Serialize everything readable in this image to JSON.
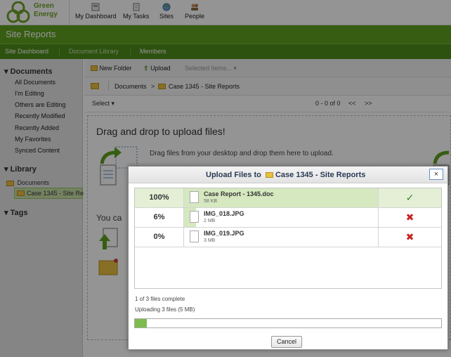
{
  "brand": {
    "name_line1": "Green",
    "name_line2": "Energy"
  },
  "nav": [
    {
      "label": "My Dashboard",
      "icon": "dashboard-icon"
    },
    {
      "label": "My Tasks",
      "icon": "tasks-icon"
    },
    {
      "label": "Sites",
      "icon": "sites-icon"
    },
    {
      "label": "People",
      "icon": "people-icon"
    }
  ],
  "site_title": "Site Reports",
  "subnav": {
    "dashboard": "Site Dashboard",
    "library": "Document Library",
    "members": "Members"
  },
  "sidebar": {
    "documents_header": "Documents",
    "documents": [
      "All Documents",
      "I'm Editing",
      "Others are Editing",
      "Recently Modified",
      "Recently Added",
      "My Favorites",
      "Synced Content"
    ],
    "library_header": "Library",
    "library_root": "Documents",
    "library_child": "Case 1345 - Site Re",
    "tags_header": "Tags"
  },
  "toolbar": {
    "new_folder": "New Folder",
    "upload": "Upload",
    "selected_items": "Selected Items..."
  },
  "breadcrumb": {
    "root": "Documents",
    "sep": ">",
    "folder": "Case 1345 - Site Reports"
  },
  "filter": {
    "select": "Select",
    "paging": "0 - 0 of 0",
    "prev": "<<",
    "next": ">>"
  },
  "dropzone": {
    "heading": "Drag and drop to upload files!",
    "text": "Drag files from your desktop and drop them here to upload.",
    "you_can": "You ca"
  },
  "dialog": {
    "title_prefix": "Upload Files to",
    "title_folder": "Case 1345 - Site Reports",
    "close": "×",
    "files": [
      {
        "percent": "100%",
        "progress": 1.0,
        "name": "Case Report - 1345.doc",
        "size": "58 KB",
        "status": "complete",
        "status_glyph": "✓",
        "status_color": "#3a8a2a"
      },
      {
        "percent": "6%",
        "progress": 0.06,
        "name": "IMG_018.JPG",
        "size": "2 MB",
        "status": "error",
        "status_glyph": "✖",
        "status_color": "#cc2222"
      },
      {
        "percent": "0%",
        "progress": 0.0,
        "name": "IMG_019.JPG",
        "size": "3 MB",
        "status": "error",
        "status_glyph": "✖",
        "status_color": "#cc2222"
      }
    ],
    "files_complete": "1 of 3 files complete",
    "uploading": "Uploading 3 files (5 MB)",
    "total_progress": 0.04,
    "cancel": "Cancel"
  },
  "colors": {
    "brand_green": "#5fa020",
    "subnav_green": "#4e8d1a",
    "progress_green": "#7dbb4e"
  }
}
